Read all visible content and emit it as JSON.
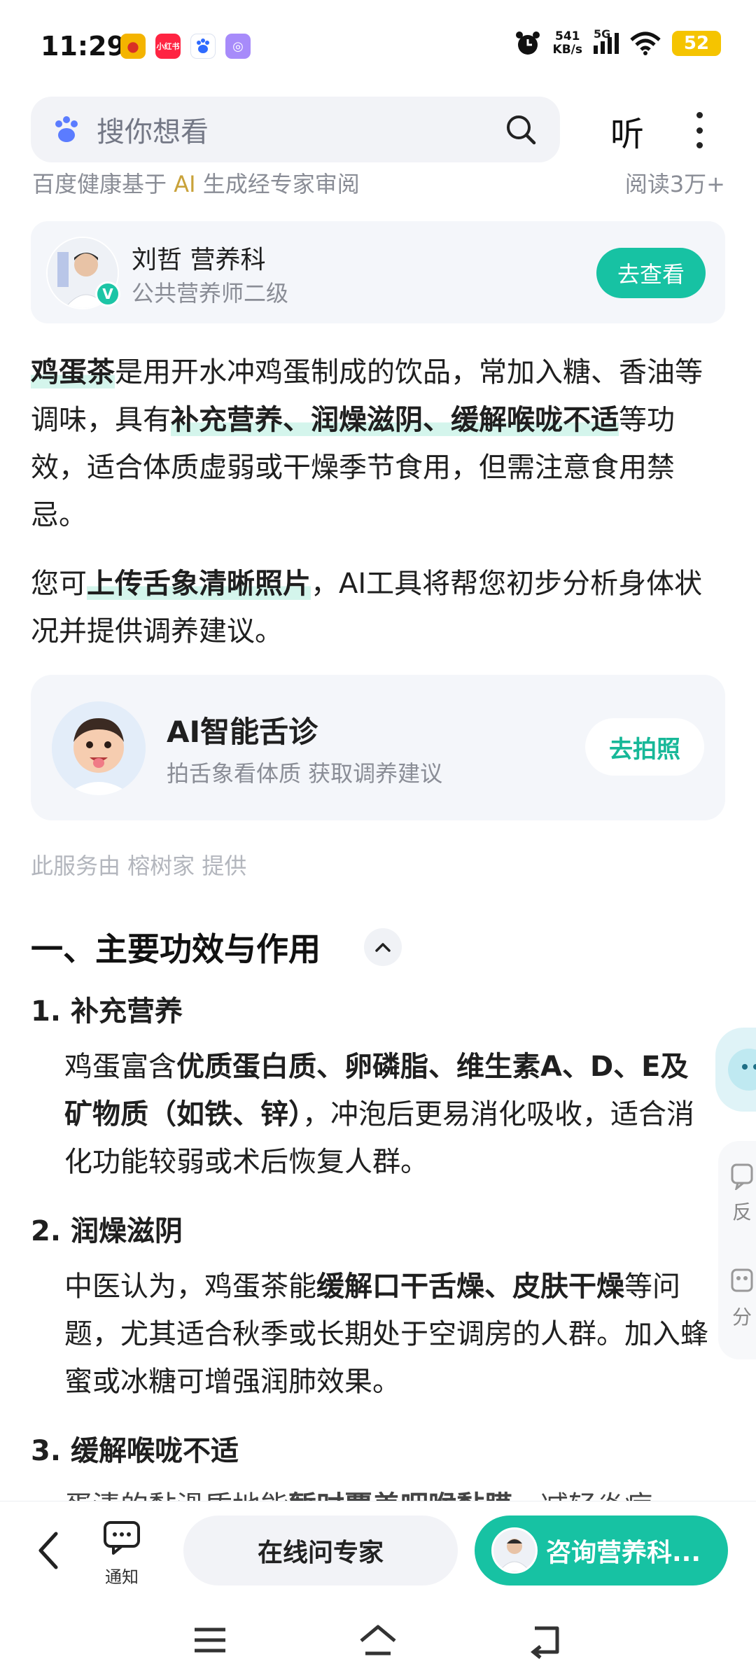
{
  "status_bar": {
    "time": "11:29",
    "app_icons": [
      "weibo-icon",
      "xiaohongshu-icon",
      "baidu-icon",
      "purple-app-icon"
    ],
    "xhs_label": "小红书",
    "net_speed_value": "541",
    "net_speed_unit": "KB/s",
    "network": "5G",
    "battery": "52"
  },
  "header": {
    "search_placeholder": "搜你想看",
    "listen_label": "听"
  },
  "source": {
    "prefix": "百度健康基于 ",
    "ai": "AI",
    "suffix": " 生成经专家审阅",
    "read_count": "阅读3万+"
  },
  "expert": {
    "name": "刘哲 营养科",
    "title": "公共营养师二级",
    "view_label": "去查看"
  },
  "intro": {
    "term": "鸡蛋茶",
    "text_a": "是用开水冲鸡蛋制成的饮品，常加入糖、香油等调味，具有",
    "highlight": "补充营养、润燥滋阴、缓解喉咙不适",
    "text_b": "等功效，适合体质虚弱或干燥季节食用，但需注意食用禁忌。"
  },
  "upload": {
    "text_a": "您可",
    "highlight": "上传舌象清晰照片",
    "text_b": "，AI工具将帮您初步分析身体状况并提供调养建议。"
  },
  "ai_card": {
    "title": "AI智能舌诊",
    "subtitle": "拍舌象看体质 获取调养建议",
    "button": "去拍照"
  },
  "service_note": "此服务由 榕树家 提供",
  "section": {
    "title": "一、主要功效与作用",
    "items": [
      {
        "title": "1. 补充营养",
        "text_a": "鸡蛋富含",
        "bold": "优质蛋白质、卵磷脂、维生素A、D、E及矿物质（如铁、锌）",
        "text_b": "，冲泡后更易消化吸收，适合消化功能较弱或术后恢复人群。"
      },
      {
        "title": "2. 润燥滋阴",
        "text_a": "中医认为，鸡蛋茶能",
        "bold": "缓解口干舌燥、皮肤干燥",
        "text_b": "等问题，尤其适合秋季或长期处于空调房的人群。加入蜂蜜或冰糖可增强润肺效果。"
      },
      {
        "title": "3. 缓解喉咙不适",
        "text_a": "蛋清的黏滑质地能",
        "bold": "暂时覆盖咽喉黏膜",
        "text_b": "，减轻炎症"
      }
    ]
  },
  "side_panel": {
    "feedback": "反",
    "share": "分"
  },
  "bottom_bar": {
    "notify_label": "通知",
    "ask_label": "在线问专家",
    "consult_label": "咨询营养科..."
  },
  "colors": {
    "accent": "#17c2a3",
    "highlight": "#d4f5ec",
    "muted_text": "#8a8d96"
  }
}
